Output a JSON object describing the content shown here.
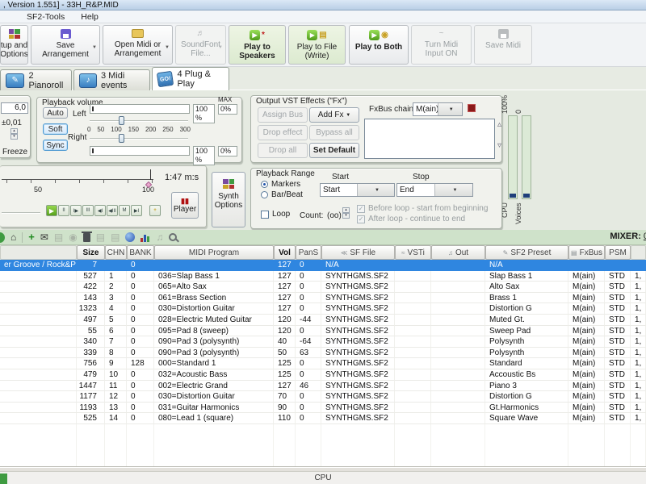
{
  "window": {
    "title": ", Version 1.551] - 33H_R&P.MID"
  },
  "menu": {
    "items": [
      {
        "label": "SF2-Tools"
      },
      {
        "label": "Help"
      }
    ]
  },
  "icons": {
    "dropdown": "▼",
    "up": "▵",
    "down": "▿",
    "caret_up": "▴",
    "caret_down": "▾",
    "check": "✓",
    "home": "⌂",
    "add": "+",
    "mail": "✉",
    "sheet": "▤",
    "globe": "◉",
    "note": "♫",
    "note_small": "♪",
    "notes2": "♬",
    "play": "▶",
    "pencil": "✎",
    "player": "▮▮",
    "star": "*",
    "squiggle": "~",
    "go": "GO!"
  },
  "toolbar": {
    "buttons": [
      {
        "label": "tup and\nOptions"
      },
      {
        "label": "Save\nArrangement"
      },
      {
        "label": "Open Midi or\nArrangement"
      },
      {
        "label": "SoundFont\nFile..."
      },
      {
        "label": "Play to\nSpeakers"
      },
      {
        "label": "Play to File\n(Write)"
      },
      {
        "label": "Play to Both"
      },
      {
        "label": "Turn Midi\nInput ON"
      },
      {
        "label": "Save Midi"
      }
    ]
  },
  "tabs": [
    {
      "label": "2 Pianoroll"
    },
    {
      "label": "3 Midi events"
    },
    {
      "label": "4 Plug & Play"
    }
  ],
  "left_panel": {
    "value": "6,0",
    "step": "±0,01",
    "freeze_label": "Freeze"
  },
  "playback_volume": {
    "title": "Playback volume",
    "auto": "Auto",
    "soft": "Soft",
    "sync": "Sync",
    "left_label": "Left",
    "right_label": "Right",
    "left_percent": "100 %",
    "right_percent": "100 %",
    "max_label": "MAX",
    "left_max": "0%",
    "right_max": "0%",
    "scale": [
      "0",
      "50",
      "100",
      "150",
      "200",
      "250",
      "300"
    ]
  },
  "vst_effects": {
    "title": "Output VST Effects (\"Fx\")",
    "assign_bus": "Assign Bus",
    "add_fx": "Add Fx",
    "drop_effect": "Drop effect",
    "bypass_all": "Bypass all",
    "drop_all": "Drop all",
    "set_default": "Set Default",
    "fxbus_label": "FxBus chain",
    "fxbus_value": "M(ain)"
  },
  "transport": {
    "time": "1:47 m:s",
    "ruler_label_50": "50",
    "ruler_label_100": "100",
    "buttons": [
      {
        "name": "play-button1",
        "glyph": "▶"
      },
      {
        "name": "pause-button",
        "glyph": "II"
      },
      {
        "name": "step-forward-button",
        "glyph": "I▶"
      },
      {
        "name": "fast-forward-button",
        "glyph": "III"
      },
      {
        "name": "step-back-button",
        "glyph": "◀I"
      },
      {
        "name": "rewind-button",
        "glyph": "◀III"
      },
      {
        "name": "marker-button",
        "glyph": "M"
      },
      {
        "name": "to-end-button",
        "glyph": "▶I"
      }
    ],
    "player_label": "Player"
  },
  "synth_options": {
    "label": "Synth\nOptions"
  },
  "playback_range": {
    "title": "Playback Range",
    "radio_markers": "Markers",
    "radio_barbeat": "Bar/Beat",
    "start_label": "Start",
    "stop_label": "Stop",
    "start_value": "Start",
    "stop_value": "End",
    "loop_label": "Loop",
    "count_label": "Count:",
    "count_value": "(oo)",
    "before_label": "Before loop - start from beginning",
    "after_label": "After loop - continue to end"
  },
  "meters": {
    "cpu_top": "100%",
    "cpu_label": "CPU",
    "voices_top": "0",
    "voices_label": "Voices"
  },
  "mixer": {
    "label": "MIXER:",
    "value": "0"
  },
  "table": {
    "headers": [
      "",
      "Size",
      "CHN",
      "BANK",
      "MIDI Program",
      "Vol",
      "PanS",
      "SF File",
      "VSTi",
      "Out",
      "SF2 Preset",
      "FxBus",
      "PSM",
      ""
    ],
    "header_icons": {
      "sf_file": "≪",
      "vsti": "≈",
      "out": "♫",
      "preset": "✎",
      "fxbus": "▤"
    },
    "selected_row": {
      "name": "er Groove / Rock&Pop",
      "size": "7",
      "chn": "",
      "bank": "0",
      "program": "",
      "vol": "127",
      "pan": "0",
      "sf_file": "N/A",
      "vsti": "",
      "out": "",
      "preset": "N/A",
      "fxbus": "",
      "psm": "",
      "extra": ""
    },
    "rows": [
      {
        "name": "",
        "size": "527",
        "chn": "1",
        "bank": "0",
        "program": "036=Slap Bass 1",
        "vol": "127",
        "pan": "0",
        "sf_file": "SYNTHGMS.SF2",
        "vsti": "",
        "out": "",
        "preset": "Slap Bass 1",
        "fxbus": "M(ain)",
        "psm": "STD",
        "extra": "1,"
      },
      {
        "name": "",
        "size": "422",
        "chn": "2",
        "bank": "0",
        "program": "065=Alto Sax",
        "vol": "127",
        "pan": "0",
        "sf_file": "SYNTHGMS.SF2",
        "vsti": "",
        "out": "",
        "preset": "Alto Sax",
        "fxbus": "M(ain)",
        "psm": "STD",
        "extra": "1,"
      },
      {
        "name": "",
        "size": "143",
        "chn": "3",
        "bank": "0",
        "program": "061=Brass Section",
        "vol": "127",
        "pan": "0",
        "sf_file": "SYNTHGMS.SF2",
        "vsti": "",
        "out": "",
        "preset": "Brass 1",
        "fxbus": "M(ain)",
        "psm": "STD",
        "extra": "1,"
      },
      {
        "name": "",
        "size": "1323",
        "chn": "4",
        "bank": "0",
        "program": "030=Distortion Guitar",
        "vol": "127",
        "pan": "0",
        "sf_file": "SYNTHGMS.SF2",
        "vsti": "",
        "out": "",
        "preset": "Distortion G",
        "fxbus": "M(ain)",
        "psm": "STD",
        "extra": "1,"
      },
      {
        "name": "",
        "size": "497",
        "chn": "5",
        "bank": "0",
        "program": "028=Electric Muted Guitar",
        "vol": "120",
        "pan": "-44",
        "sf_file": "SYNTHGMS.SF2",
        "vsti": "",
        "out": "",
        "preset": "Muted Gt.",
        "fxbus": "M(ain)",
        "psm": "STD",
        "extra": "1,"
      },
      {
        "name": "",
        "size": "55",
        "chn": "6",
        "bank": "0",
        "program": "095=Pad 8 (sweep)",
        "vol": "120",
        "pan": "0",
        "sf_file": "SYNTHGMS.SF2",
        "vsti": "",
        "out": "",
        "preset": "Sweep Pad",
        "fxbus": "M(ain)",
        "psm": "STD",
        "extra": "1,"
      },
      {
        "name": "",
        "size": "340",
        "chn": "7",
        "bank": "0",
        "program": "090=Pad 3 (polysynth)",
        "vol": "40",
        "pan": "-64",
        "sf_file": "SYNTHGMS.SF2",
        "vsti": "",
        "out": "",
        "preset": "Polysynth",
        "fxbus": "M(ain)",
        "psm": "STD",
        "extra": "1,"
      },
      {
        "name": "",
        "size": "339",
        "chn": "8",
        "bank": "0",
        "program": "090=Pad 3 (polysynth)",
        "vol": "50",
        "pan": "63",
        "sf_file": "SYNTHGMS.SF2",
        "vsti": "",
        "out": "",
        "preset": "Polysynth",
        "fxbus": "M(ain)",
        "psm": "STD",
        "extra": "1,"
      },
      {
        "name": "",
        "size": "756",
        "chn": "9",
        "bank": "128",
        "program": "000=Standard 1",
        "vol": "125",
        "pan": "0",
        "sf_file": "SYNTHGMS.SF2",
        "vsti": "",
        "out": "",
        "preset": "Standard",
        "fxbus": "M(ain)",
        "psm": "STD",
        "extra": "1,"
      },
      {
        "name": "",
        "size": "479",
        "chn": "10",
        "bank": "0",
        "program": "032=Acoustic Bass",
        "vol": "125",
        "pan": "0",
        "sf_file": "SYNTHGMS.SF2",
        "vsti": "",
        "out": "",
        "preset": "Accoustic Bs",
        "fxbus": "M(ain)",
        "psm": "STD",
        "extra": "1,"
      },
      {
        "name": "",
        "size": "1447",
        "chn": "11",
        "bank": "0",
        "program": "002=Electric Grand",
        "vol": "127",
        "pan": "46",
        "sf_file": "SYNTHGMS.SF2",
        "vsti": "",
        "out": "",
        "preset": "Piano 3",
        "fxbus": "M(ain)",
        "psm": "STD",
        "extra": "1,"
      },
      {
        "name": "",
        "size": "1177",
        "chn": "12",
        "bank": "0",
        "program": "030=Distortion Guitar",
        "vol": "70",
        "pan": "0",
        "sf_file": "SYNTHGMS.SF2",
        "vsti": "",
        "out": "",
        "preset": "Distortion G",
        "fxbus": "M(ain)",
        "psm": "STD",
        "extra": "1,"
      },
      {
        "name": "",
        "size": "1193",
        "chn": "13",
        "bank": "0",
        "program": "031=Guitar Harmonics",
        "vol": "90",
        "pan": "0",
        "sf_file": "SYNTHGMS.SF2",
        "vsti": "",
        "out": "",
        "preset": "Gt.Harmonics",
        "fxbus": "M(ain)",
        "psm": "STD",
        "extra": "1,"
      },
      {
        "name": "",
        "size": "525",
        "chn": "14",
        "bank": "0",
        "program": "080=Lead 1 (square)",
        "vol": "110",
        "pan": "0",
        "sf_file": "SYNTHGMS.SF2",
        "vsti": "",
        "out": "",
        "preset": "Square Wave",
        "fxbus": "M(ain)",
        "psm": "STD",
        "extra": "1,"
      }
    ]
  },
  "status_bar": {
    "label": "CPU"
  }
}
